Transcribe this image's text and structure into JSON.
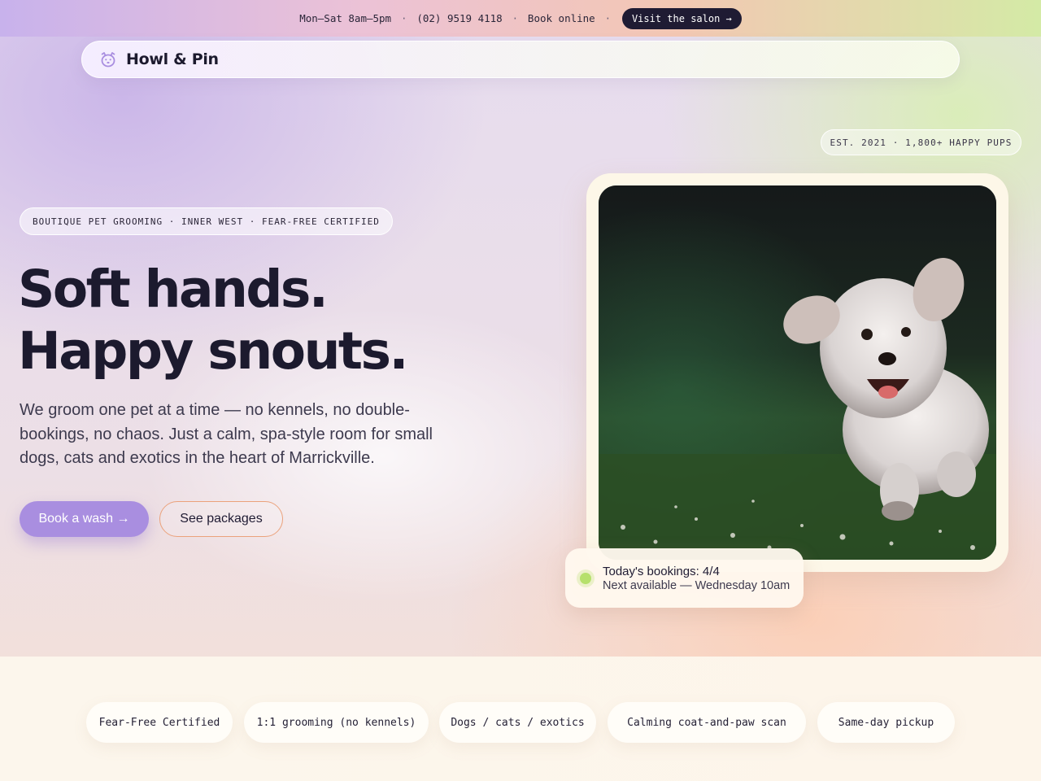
{
  "topbar": {
    "hours": "Mon–Sat 8am–5pm",
    "separator": "·",
    "phone": "(02) 9519 4118",
    "book_online": "Book online",
    "cta_label": "Visit the salon →"
  },
  "nav": {
    "brand_name": "Howl & Pin",
    "brand_icon": "dog-face-icon"
  },
  "hero": {
    "eyebrow": "BOUTIQUE PET GROOMING · INNER WEST · FEAR-FREE CERTIFIED",
    "headline_line1": "Soft hands.",
    "headline_line2": "Happy snouts.",
    "lede": "We groom one pet at a time — no kennels, no double-bookings, no chaos. Just a calm, spa-style room for small dogs, cats and exotics in the heart of Marrickville.",
    "primary_button": "Book a wash →",
    "secondary_button": "See packages",
    "est_badge": "EST. 2021 · 1,800+ HAPPY PUPS",
    "photo_subject": "fluffy white dog running on grass"
  },
  "status": {
    "title": "Today's bookings: 4/4",
    "subtitle": "Next available — Wednesday 10am",
    "indicator_color": "#b6e06c"
  },
  "features": [
    "Fear-Free Certified",
    "1:1 grooming (no kennels)",
    "Dogs / cats / exotics",
    "Calming coat-and-paw scan",
    "Same-day pickup"
  ],
  "colors": {
    "accent": "#a98ee0",
    "dark": "#1f1b33",
    "outline": "#eba27c"
  }
}
